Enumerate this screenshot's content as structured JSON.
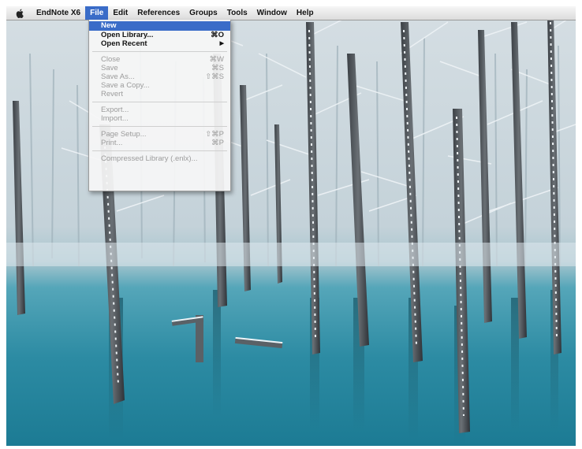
{
  "menubar": {
    "app_name": "EndNote X6",
    "items": [
      "File",
      "Edit",
      "References",
      "Groups",
      "Tools",
      "Window",
      "Help"
    ],
    "active_item": "File"
  },
  "file_menu": {
    "groups": [
      [
        {
          "label": "New",
          "shortcut": "",
          "state": "highlighted"
        },
        {
          "label": "Open Library...",
          "shortcut": "⌘O",
          "state": "enabled"
        },
        {
          "label": "Open Recent",
          "shortcut": "▶",
          "state": "enabled"
        }
      ],
      [
        {
          "label": "Close",
          "shortcut": "⌘W",
          "state": "disabled"
        },
        {
          "label": "Save",
          "shortcut": "⌘S",
          "state": "disabled"
        },
        {
          "label": "Save As...",
          "shortcut": "⇧⌘S",
          "state": "disabled"
        },
        {
          "label": "Save a Copy...",
          "shortcut": "",
          "state": "disabled"
        },
        {
          "label": "Revert",
          "shortcut": "",
          "state": "disabled"
        }
      ],
      [
        {
          "label": "Export...",
          "shortcut": "",
          "state": "disabled"
        },
        {
          "label": "Import...",
          "shortcut": "",
          "state": "disabled"
        }
      ],
      [
        {
          "label": "Page Setup...",
          "shortcut": "⇧⌘P",
          "state": "disabled"
        },
        {
          "label": "Print...",
          "shortcut": "⌘P",
          "state": "disabled"
        }
      ],
      [
        {
          "label": "Compressed Library (.enlx)...",
          "shortcut": "",
          "state": "disabled"
        }
      ]
    ]
  },
  "colors": {
    "highlight": "#3a6cc8",
    "water": "#2b8aa3",
    "snow": "#e4ecf0"
  },
  "icons": {
    "apple_menu": "apple-icon",
    "submenu": "chevron-right-icon"
  }
}
